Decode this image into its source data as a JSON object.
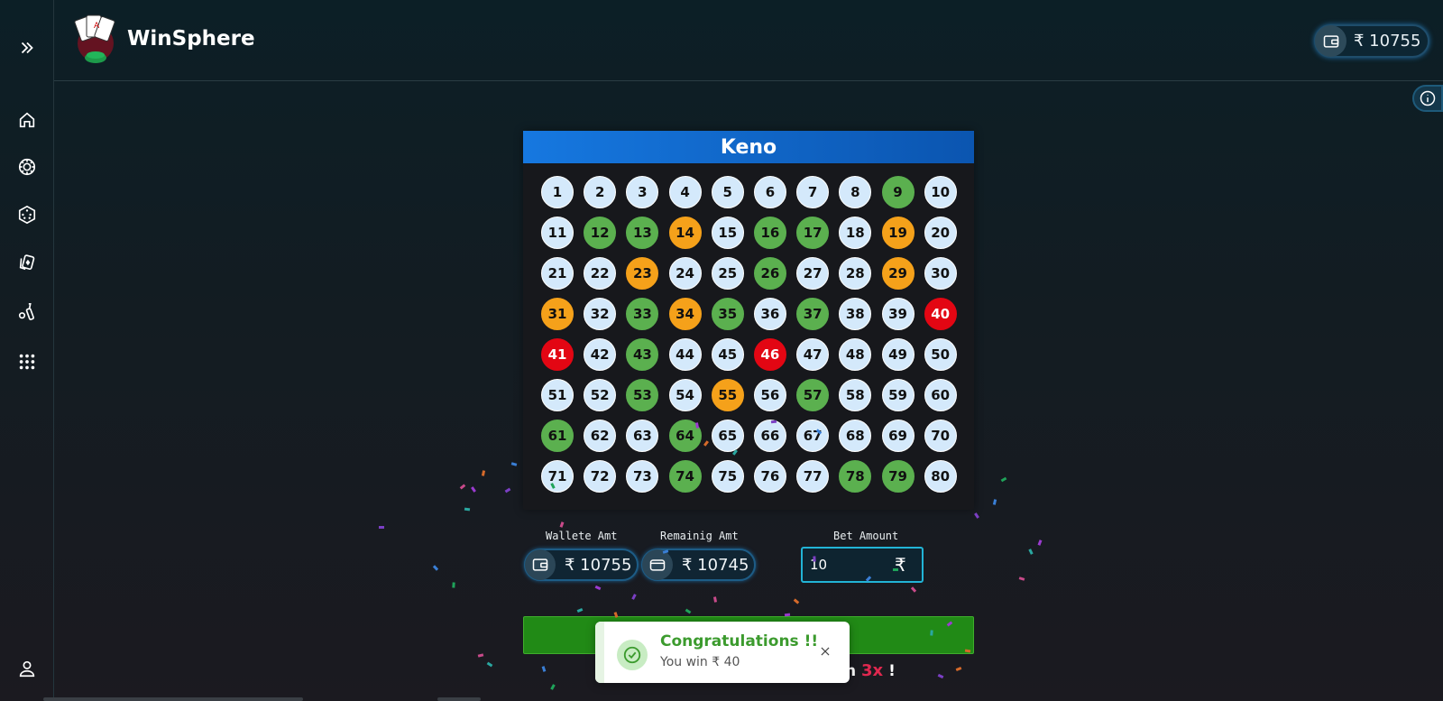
{
  "app": {
    "brand": "WinSphere"
  },
  "header": {
    "wallet_amount": "₹ 10755"
  },
  "sidebar": {
    "items": [
      {
        "name": "expand-icon"
      },
      {
        "name": "home-icon"
      },
      {
        "name": "casino-chip-icon"
      },
      {
        "name": "dice-icon"
      },
      {
        "name": "cards-icon"
      },
      {
        "name": "cricket-icon"
      },
      {
        "name": "apps-grid-icon"
      },
      {
        "name": "user-icon"
      }
    ]
  },
  "keno": {
    "title": "Keno",
    "balls": [
      {
        "n": "1",
        "s": ""
      },
      {
        "n": "2",
        "s": ""
      },
      {
        "n": "3",
        "s": ""
      },
      {
        "n": "4",
        "s": ""
      },
      {
        "n": "5",
        "s": ""
      },
      {
        "n": "6",
        "s": ""
      },
      {
        "n": "7",
        "s": ""
      },
      {
        "n": "8",
        "s": ""
      },
      {
        "n": "9",
        "s": "g"
      },
      {
        "n": "10",
        "s": ""
      },
      {
        "n": "11",
        "s": ""
      },
      {
        "n": "12",
        "s": "g"
      },
      {
        "n": "13",
        "s": "g"
      },
      {
        "n": "14",
        "s": "o"
      },
      {
        "n": "15",
        "s": ""
      },
      {
        "n": "16",
        "s": "g"
      },
      {
        "n": "17",
        "s": "g"
      },
      {
        "n": "18",
        "s": ""
      },
      {
        "n": "19",
        "s": "o"
      },
      {
        "n": "20",
        "s": ""
      },
      {
        "n": "21",
        "s": ""
      },
      {
        "n": "22",
        "s": ""
      },
      {
        "n": "23",
        "s": "o"
      },
      {
        "n": "24",
        "s": ""
      },
      {
        "n": "25",
        "s": ""
      },
      {
        "n": "26",
        "s": "g"
      },
      {
        "n": "27",
        "s": ""
      },
      {
        "n": "28",
        "s": ""
      },
      {
        "n": "29",
        "s": "o"
      },
      {
        "n": "30",
        "s": ""
      },
      {
        "n": "31",
        "s": "o"
      },
      {
        "n": "32",
        "s": ""
      },
      {
        "n": "33",
        "s": "g"
      },
      {
        "n": "34",
        "s": "o"
      },
      {
        "n": "35",
        "s": "g"
      },
      {
        "n": "36",
        "s": ""
      },
      {
        "n": "37",
        "s": "g"
      },
      {
        "n": "38",
        "s": ""
      },
      {
        "n": "39",
        "s": ""
      },
      {
        "n": "40",
        "s": "r"
      },
      {
        "n": "41",
        "s": "r"
      },
      {
        "n": "42",
        "s": ""
      },
      {
        "n": "43",
        "s": "g"
      },
      {
        "n": "44",
        "s": ""
      },
      {
        "n": "45",
        "s": ""
      },
      {
        "n": "46",
        "s": "r"
      },
      {
        "n": "47",
        "s": ""
      },
      {
        "n": "48",
        "s": ""
      },
      {
        "n": "49",
        "s": ""
      },
      {
        "n": "50",
        "s": ""
      },
      {
        "n": "51",
        "s": ""
      },
      {
        "n": "52",
        "s": ""
      },
      {
        "n": "53",
        "s": "g"
      },
      {
        "n": "54",
        "s": ""
      },
      {
        "n": "55",
        "s": "o"
      },
      {
        "n": "56",
        "s": ""
      },
      {
        "n": "57",
        "s": "g"
      },
      {
        "n": "58",
        "s": ""
      },
      {
        "n": "59",
        "s": ""
      },
      {
        "n": "60",
        "s": ""
      },
      {
        "n": "61",
        "s": "g"
      },
      {
        "n": "62",
        "s": ""
      },
      {
        "n": "63",
        "s": ""
      },
      {
        "n": "64",
        "s": "g"
      },
      {
        "n": "65",
        "s": ""
      },
      {
        "n": "66",
        "s": ""
      },
      {
        "n": "67",
        "s": ""
      },
      {
        "n": "68",
        "s": ""
      },
      {
        "n": "69",
        "s": ""
      },
      {
        "n": "70",
        "s": ""
      },
      {
        "n": "71",
        "s": ""
      },
      {
        "n": "72",
        "s": ""
      },
      {
        "n": "73",
        "s": ""
      },
      {
        "n": "74",
        "s": "g"
      },
      {
        "n": "75",
        "s": ""
      },
      {
        "n": "76",
        "s": ""
      },
      {
        "n": "77",
        "s": ""
      },
      {
        "n": "78",
        "s": "g"
      },
      {
        "n": "79",
        "s": "g"
      },
      {
        "n": "80",
        "s": ""
      }
    ]
  },
  "amounts": {
    "wallet_label": "Wallete Amt",
    "wallet_value": "₹ 10755",
    "remaining_label": "Remainig Amt",
    "remaining_value": "₹ 10745",
    "bet_label": "Bet Amount",
    "bet_value": "10",
    "bet_currency": "₹"
  },
  "payout": {
    "prefix": "n",
    "multiplier": "3x",
    "suffix": "!"
  },
  "toast": {
    "title": "Congratulations !!",
    "message": "You win ₹ 40"
  },
  "colors": {
    "green": "#5bb04f",
    "orange": "#f5a11a",
    "red": "#e30613",
    "default": "#d4e9fb",
    "header_blue": "#1678e0"
  }
}
